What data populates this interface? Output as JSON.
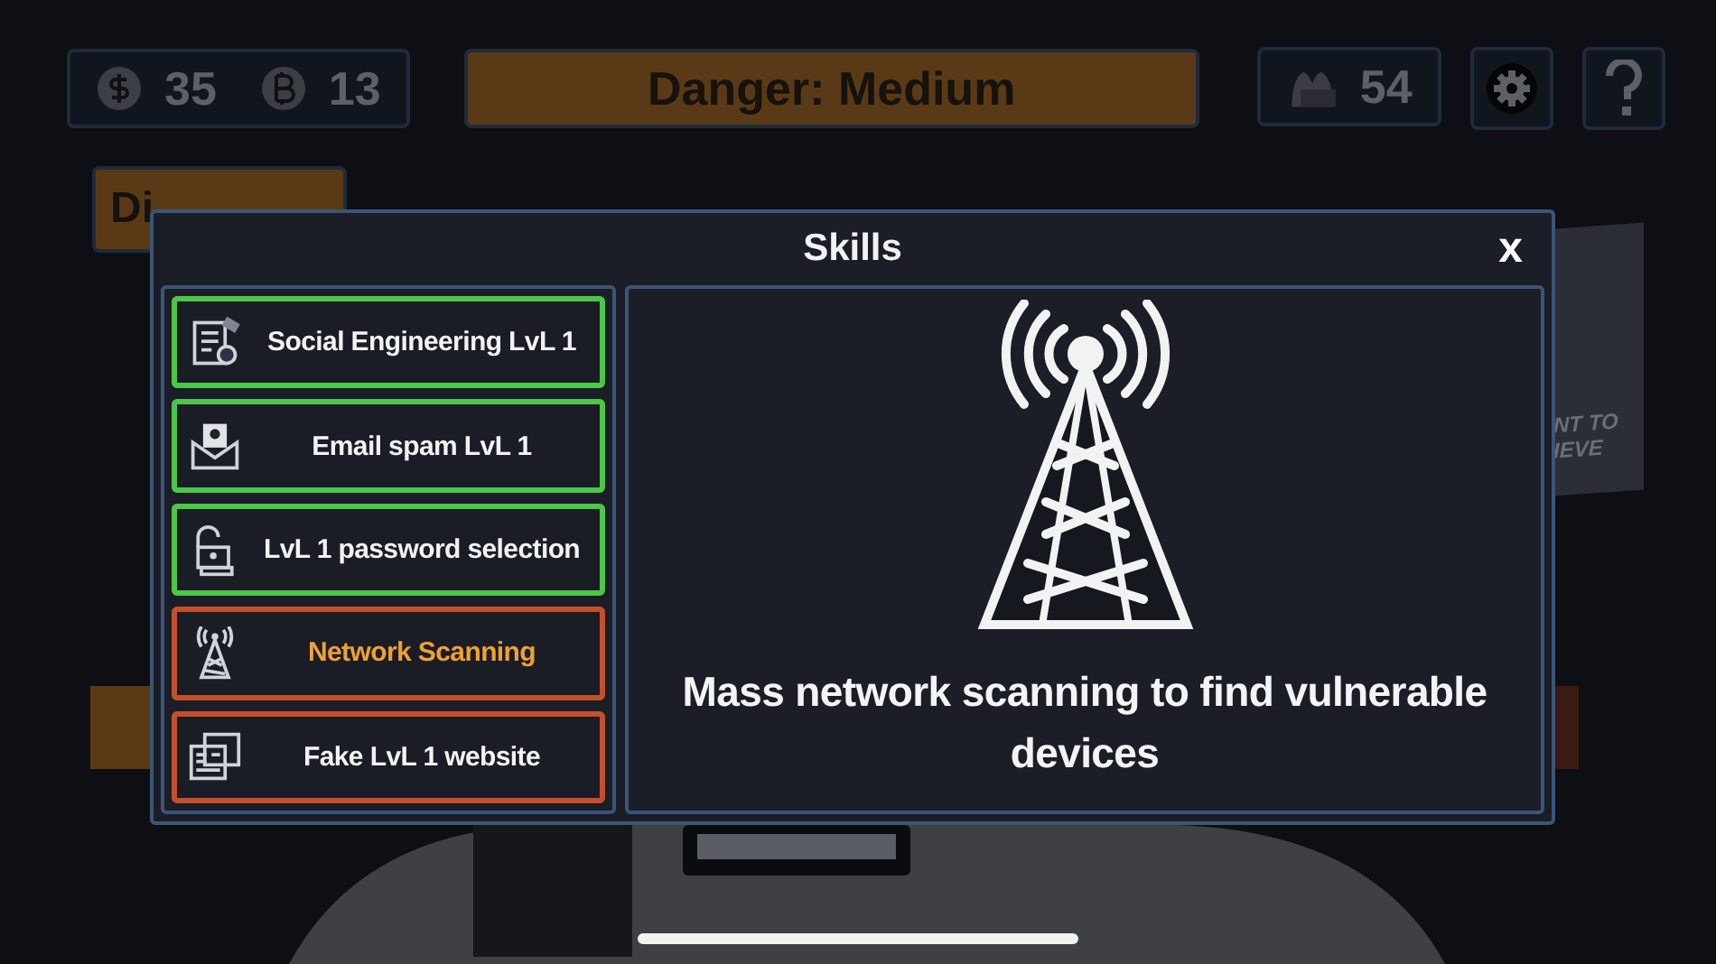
{
  "hud": {
    "money": "35",
    "bitcoin": "13",
    "danger": "Danger: Medium",
    "gang": "54"
  },
  "background_buttons": [
    {
      "label": "Di"
    }
  ],
  "poster": {
    "lines": [
      "NT TO",
      "IEVE"
    ]
  },
  "modal": {
    "title": "Skills",
    "close": "x",
    "skills": [
      {
        "name": "Social Engineering LvL 1",
        "kind": "checklist",
        "unlocked": true,
        "selected": false
      },
      {
        "name": "Email spam LvL 1",
        "kind": "mail",
        "unlocked": true,
        "selected": false
      },
      {
        "name": "LvL 1 password selection",
        "kind": "lock",
        "unlocked": true,
        "selected": false
      },
      {
        "name": "Network Scanning",
        "kind": "tower",
        "unlocked": false,
        "selected": true
      },
      {
        "name": "Fake LvL 1 website",
        "kind": "web",
        "unlocked": false,
        "selected": false
      }
    ],
    "detail": {
      "kind": "tower",
      "description": "Mass network scanning to find vulnerable devices"
    }
  }
}
